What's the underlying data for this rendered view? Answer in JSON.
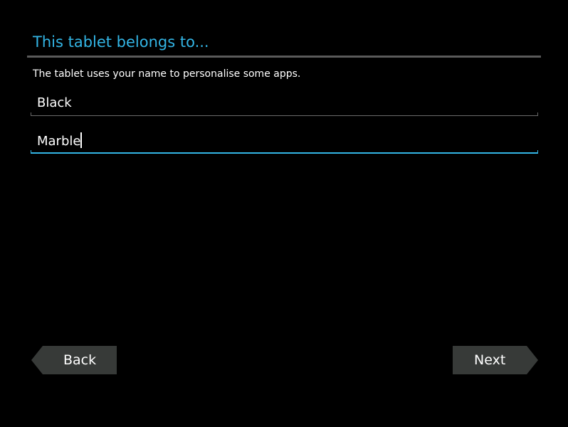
{
  "header": {
    "title": "This tablet belongs to..."
  },
  "description": "The tablet uses your name to personalise some apps.",
  "form": {
    "first_name": {
      "value": "Black"
    },
    "last_name": {
      "value": "Marble"
    }
  },
  "navigation": {
    "back_label": "Back",
    "next_label": "Next"
  },
  "colors": {
    "accent": "#33b5e5",
    "background": "#000000",
    "button_bg": "#373a38",
    "divider": "#5a5a5a"
  }
}
